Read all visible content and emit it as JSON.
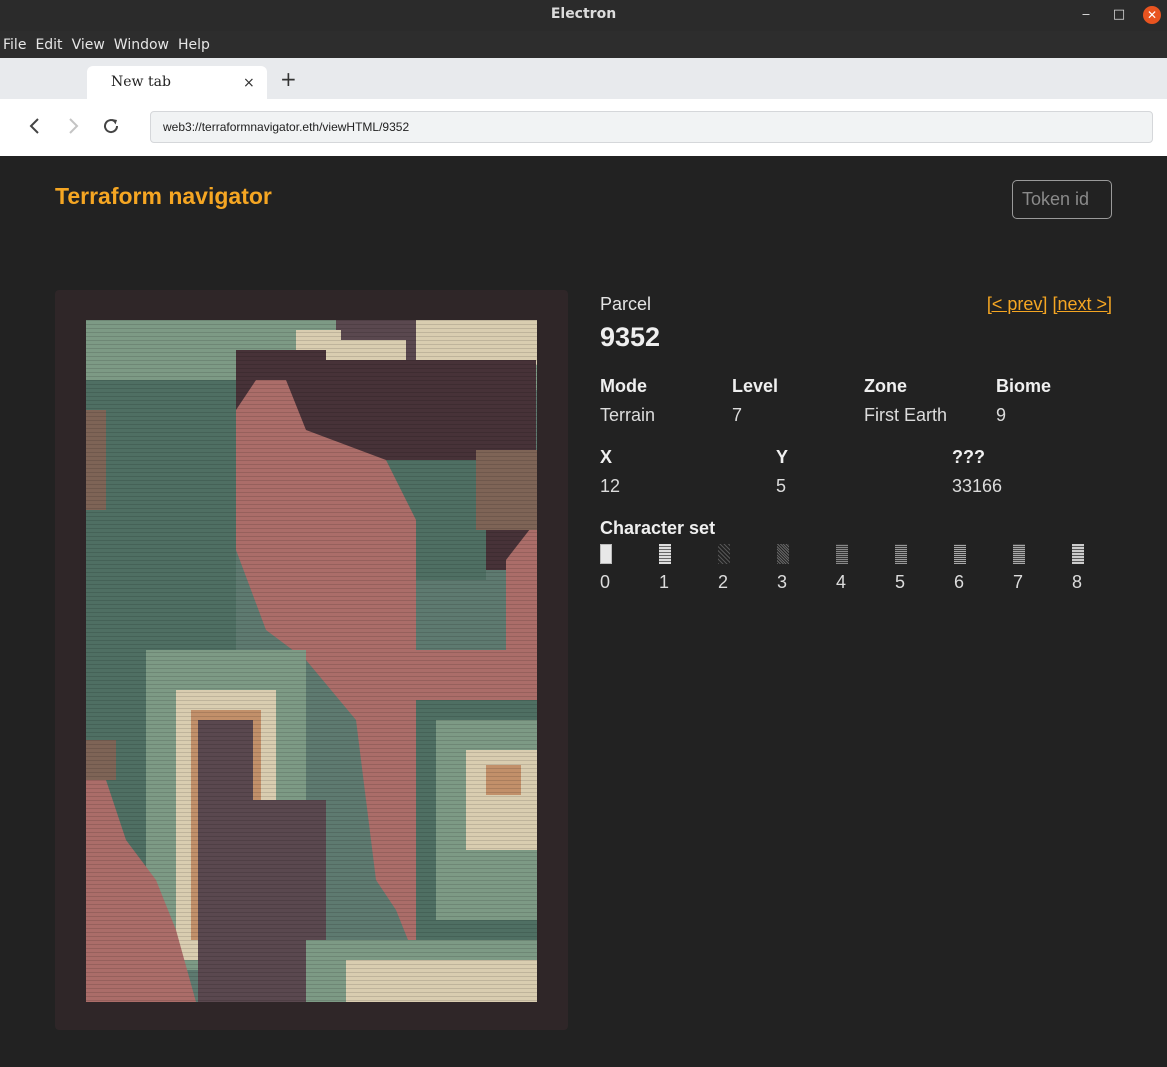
{
  "window": {
    "title": "Electron",
    "min": "‒",
    "max": "□",
    "close": "✕"
  },
  "menu": [
    "File",
    "Edit",
    "View",
    "Window",
    "Help"
  ],
  "tab": {
    "label": "New tab",
    "close": "×",
    "new": "+"
  },
  "nav": {
    "back": "‹",
    "forward": "›",
    "reload": "↻",
    "url": "web3://terraformnavigator.eth/viewHTML/9352"
  },
  "header": {
    "brand": "Terraform navigator",
    "token_placeholder": "Token id"
  },
  "parcel": {
    "label": "Parcel",
    "number": "9352",
    "prev": "[< prev]",
    "next": "[next >]",
    "fields": [
      {
        "key": "Mode",
        "value": "Terrain"
      },
      {
        "key": "Level",
        "value": "7"
      },
      {
        "key": "Zone",
        "value": "First Earth"
      },
      {
        "key": "Biome",
        "value": "9"
      }
    ],
    "coords": [
      {
        "key": "X",
        "value": "12"
      },
      {
        "key": "Y",
        "value": "5"
      },
      {
        "key": "???",
        "value": "33166"
      }
    ],
    "charset_label": "Character set",
    "charset_indices": [
      "0",
      "1",
      "2",
      "3",
      "4",
      "5",
      "6",
      "7",
      "8"
    ]
  },
  "palette": {
    "accent": "#f5a623",
    "pink": "#ab6d69",
    "dark_purple": "#5a484f",
    "maroon": "#473238",
    "brown": "#7e6456",
    "green": "#7d9a85",
    "dark_green": "#4f6f63",
    "cream": "#d9cdb0",
    "tan": "#c2906a"
  }
}
